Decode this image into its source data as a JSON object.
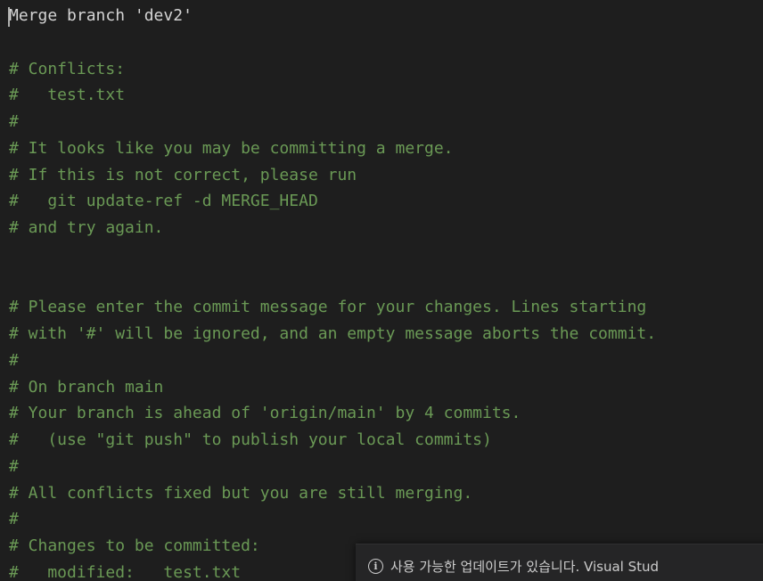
{
  "editor": {
    "lines": [
      {
        "kind": "text",
        "content": "Merge branch 'dev2'"
      },
      {
        "kind": "text",
        "content": ""
      },
      {
        "kind": "comment",
        "content": "# Conflicts:"
      },
      {
        "kind": "comment",
        "content": "#   test.txt"
      },
      {
        "kind": "comment",
        "content": "#"
      },
      {
        "kind": "comment",
        "content": "# It looks like you may be committing a merge."
      },
      {
        "kind": "comment",
        "content": "# If this is not correct, please run"
      },
      {
        "kind": "comment",
        "content": "#   git update-ref -d MERGE_HEAD"
      },
      {
        "kind": "comment",
        "content": "# and try again."
      },
      {
        "kind": "text",
        "content": ""
      },
      {
        "kind": "text",
        "content": ""
      },
      {
        "kind": "comment",
        "content": "# Please enter the commit message for your changes. Lines starting"
      },
      {
        "kind": "comment",
        "content": "# with '#' will be ignored, and an empty message aborts the commit."
      },
      {
        "kind": "comment",
        "content": "#"
      },
      {
        "kind": "comment",
        "content": "# On branch main"
      },
      {
        "kind": "comment",
        "content": "# Your branch is ahead of 'origin/main' by 4 commits."
      },
      {
        "kind": "comment",
        "content": "#   (use \"git push\" to publish your local commits)"
      },
      {
        "kind": "comment",
        "content": "#"
      },
      {
        "kind": "comment",
        "content": "# All conflicts fixed but you are still merging."
      },
      {
        "kind": "comment",
        "content": "#"
      },
      {
        "kind": "comment",
        "content": "# Changes to be committed:"
      },
      {
        "kind": "comment",
        "content": "#   modified:   test.txt"
      }
    ]
  },
  "notification": {
    "icon": "info-icon",
    "icon_glyph": "i",
    "message": "사용 가능한 업데이트가 있습니다. Visual Stud"
  },
  "colors": {
    "background": "#1e1e1e",
    "text": "#d4d4d4",
    "comment": "#6a9955",
    "notification_bg": "#252526"
  }
}
